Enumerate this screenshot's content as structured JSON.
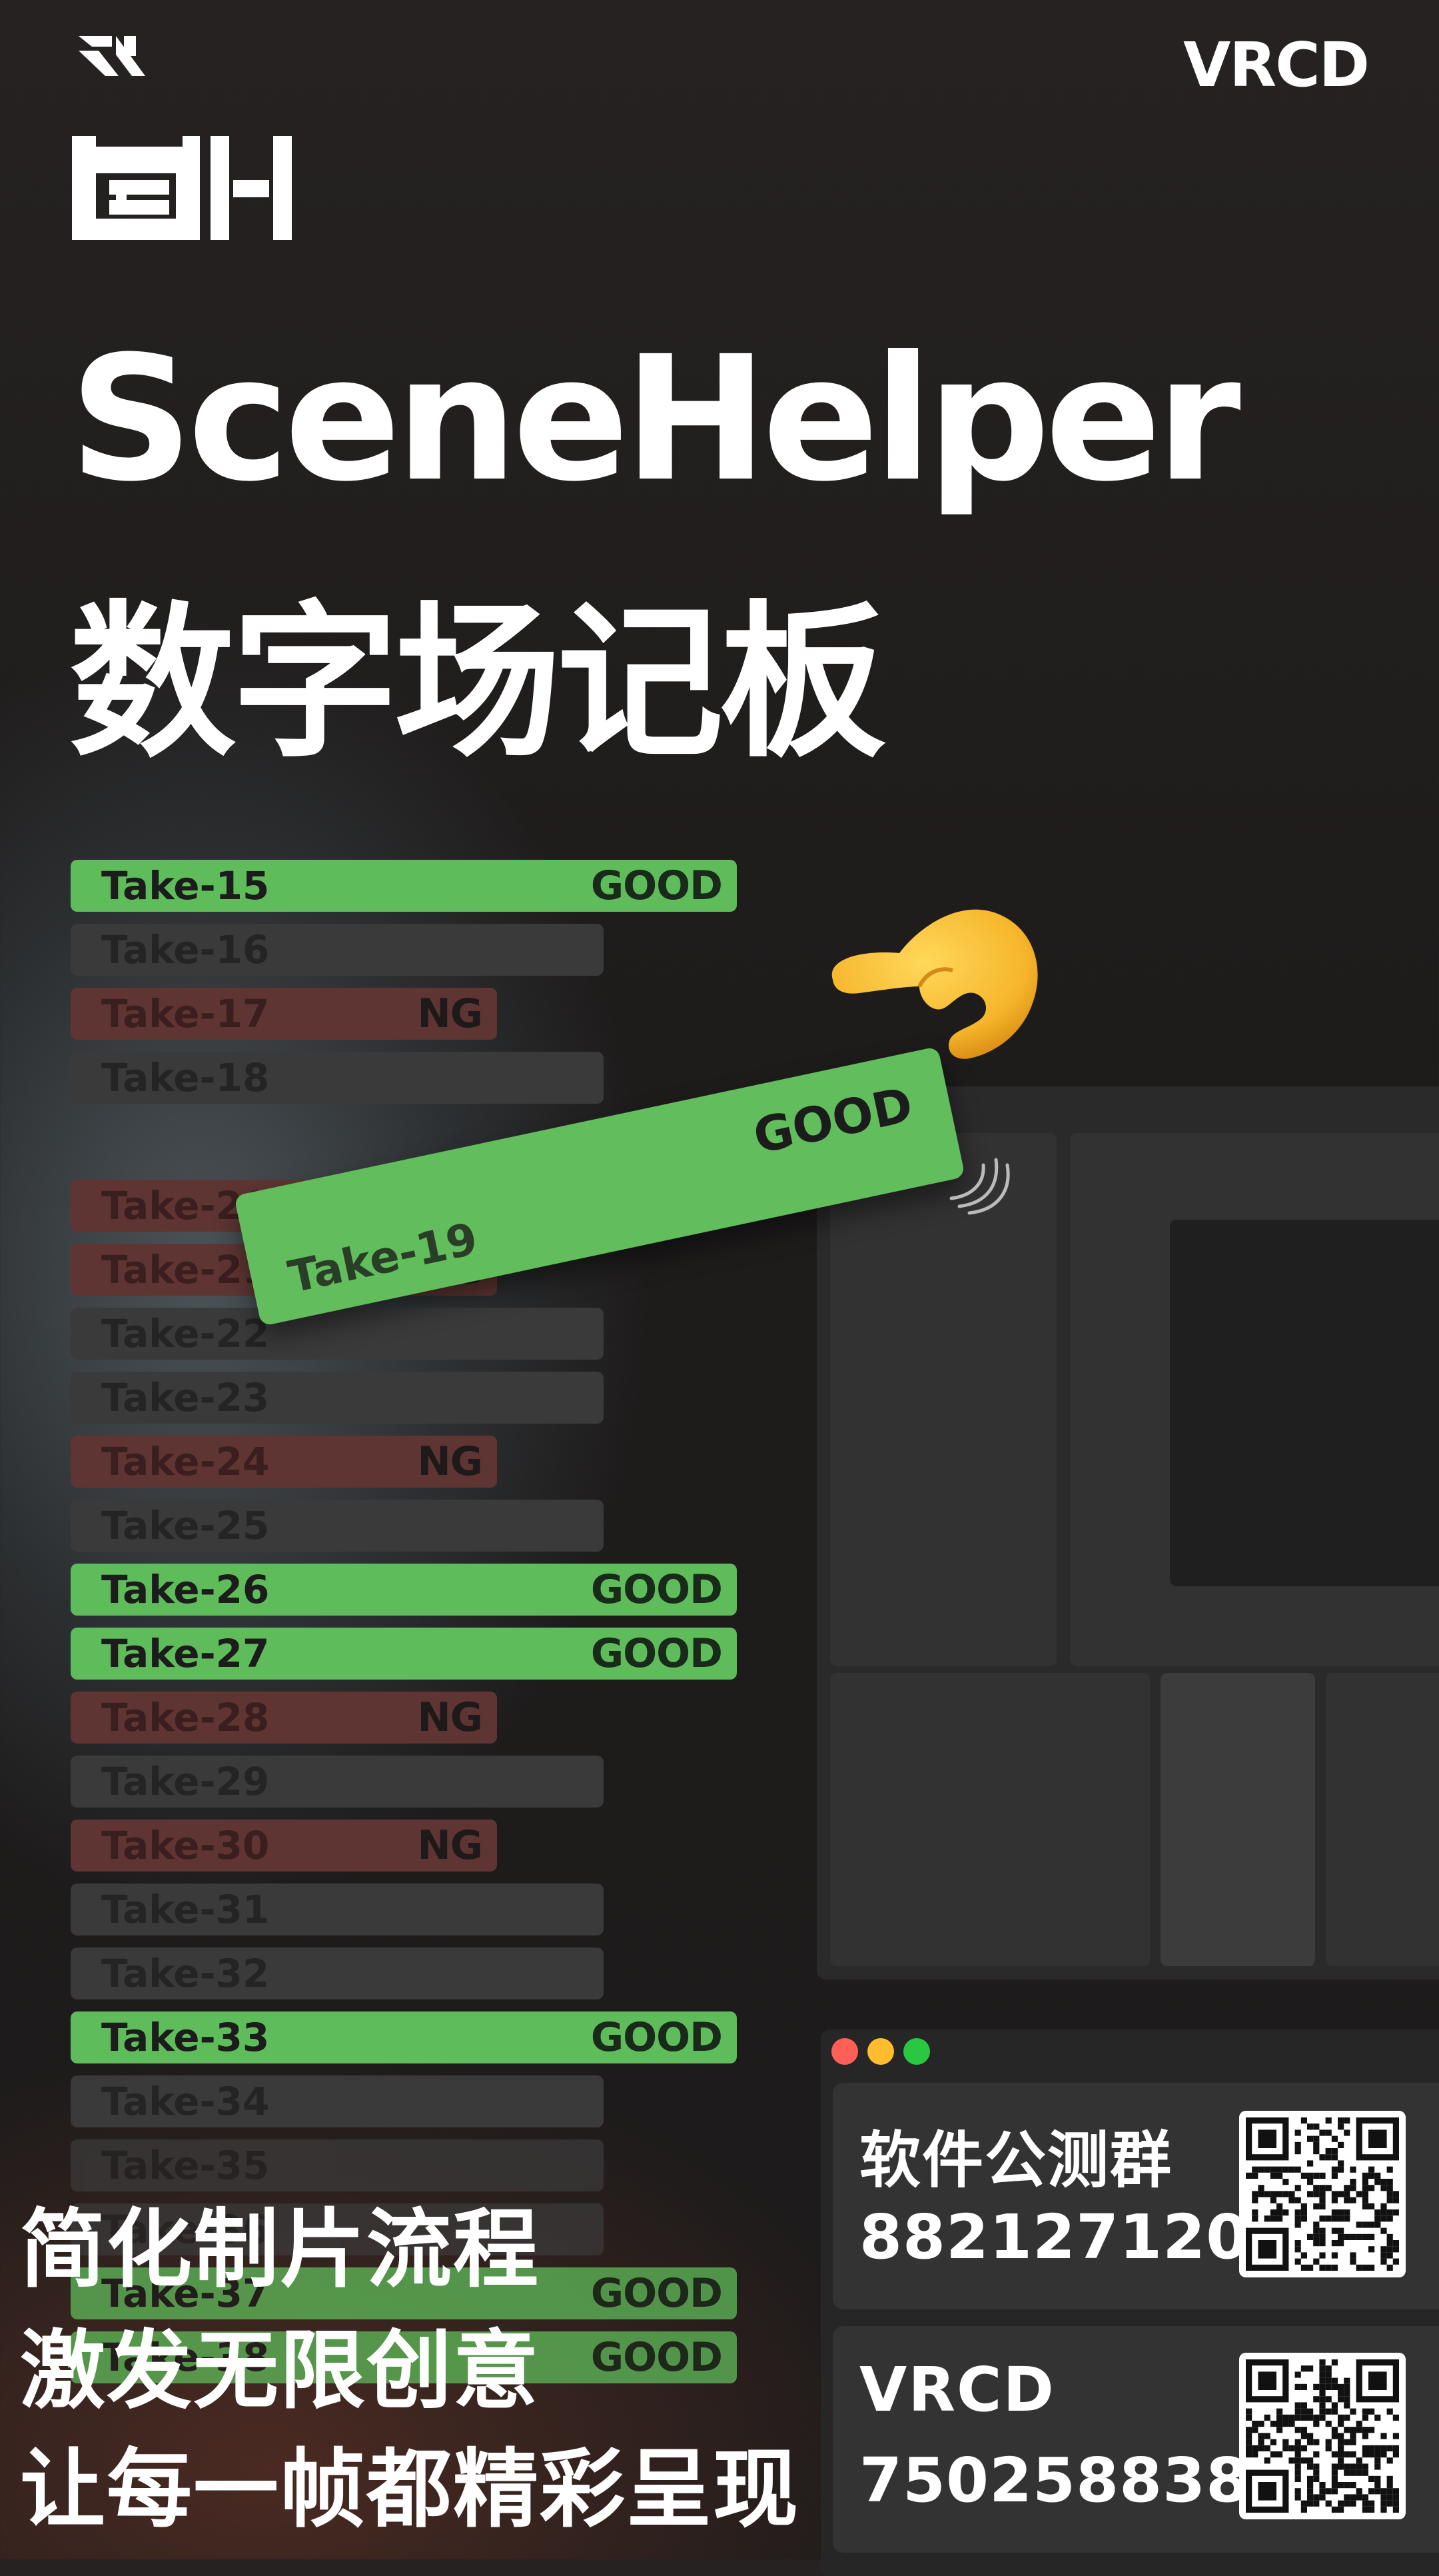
{
  "brand": {
    "vrcd_logo_text": "VRCD",
    "app_name": "SceneHelper",
    "app_subtitle": "数字场记板"
  },
  "takes": [
    {
      "label": "Take-15",
      "status": "GOOD",
      "kind": "good"
    },
    {
      "label": "Take-16",
      "status": "",
      "kind": "neutral"
    },
    {
      "label": "Take-17",
      "status": "NG",
      "kind": "ng"
    },
    {
      "label": "Take-18",
      "status": "",
      "kind": "neutral"
    },
    {
      "label": "Take-20",
      "status": "",
      "kind": "ng"
    },
    {
      "label": "Take-21",
      "status": "NG",
      "kind": "ng"
    },
    {
      "label": "Take-22",
      "status": "",
      "kind": "neutral"
    },
    {
      "label": "Take-23",
      "status": "",
      "kind": "neutral"
    },
    {
      "label": "Take-24",
      "status": "NG",
      "kind": "ng"
    },
    {
      "label": "Take-25",
      "status": "",
      "kind": "neutral"
    },
    {
      "label": "Take-26",
      "status": "GOOD",
      "kind": "good"
    },
    {
      "label": "Take-27",
      "status": "GOOD",
      "kind": "good"
    },
    {
      "label": "Take-28",
      "status": "NG",
      "kind": "ng"
    },
    {
      "label": "Take-29",
      "status": "",
      "kind": "neutral"
    },
    {
      "label": "Take-30",
      "status": "NG",
      "kind": "ng"
    },
    {
      "label": "Take-31",
      "status": "",
      "kind": "neutral"
    },
    {
      "label": "Take-32",
      "status": "",
      "kind": "neutral"
    },
    {
      "label": "Take-33",
      "status": "GOOD",
      "kind": "good"
    },
    {
      "label": "Take-34",
      "status": "",
      "kind": "neutral"
    },
    {
      "label": "Take-35",
      "status": "",
      "kind": "neutral"
    },
    {
      "label": "Take-36",
      "status": "",
      "kind": "neutral"
    },
    {
      "label": "Take-37",
      "status": "GOOD",
      "kind": "good"
    },
    {
      "label": "Take-38",
      "status": "GOOD",
      "kind": "good"
    }
  ],
  "flying_take": {
    "label": "Take-19",
    "status": "GOOD"
  },
  "icons": {
    "hand": "pinching-hand-icon",
    "motion": "motion-lines-icon",
    "top_logo": "vrcd-mark-icon",
    "app_logo": "scenehelper-logo-icon"
  },
  "colors": {
    "good": "#5fbc5a",
    "ng": "#5e3533",
    "neutral": "#3b3a3a",
    "traffic_red": "#ff5f57",
    "traffic_yellow": "#febc2e",
    "traffic_green": "#28c840"
  },
  "contacts": [
    {
      "title": "软件公测群",
      "number": "882127120"
    },
    {
      "title": "VRCD",
      "number": "750258838"
    }
  ],
  "slogans": [
    "简化制片流程",
    "激发无限创意",
    "让每一帧都精彩呈现"
  ]
}
